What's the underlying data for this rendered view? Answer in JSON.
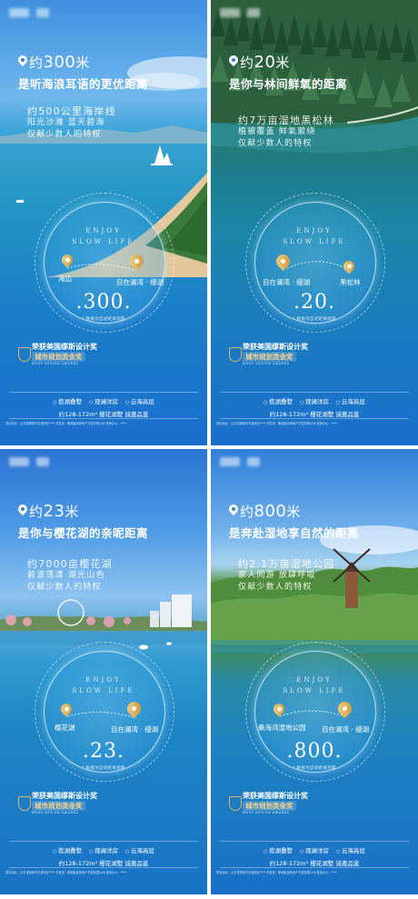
{
  "posters": [
    {
      "heading_prefix": "约",
      "heading_number": "300",
      "heading_unit": "米",
      "subtitle": "是听海浪耳语的更优距离",
      "body_line1": "约500公里海岸线",
      "body_line2": "阳光沙滩 蓝天碧海",
      "body_line3": "仅献少数人的特权",
      "enjoy_line1": "ENJOY",
      "enjoy_line2": "SLOW LIFE",
      "location_left": "海边",
      "location_right": "自在澜湾 · 缦湖",
      "big_number": ".300.",
      "note": "* 数据为自述距离测量",
      "award_line1": "荣获美国缪斯设计奖",
      "award_line2": "城市规划类金奖",
      "award_line3": "MUSE DESIGN AWARDS",
      "tags": [
        "揽湖叠墅",
        "观澜洋房",
        "云海高层"
      ],
      "spec": "约128-172m² 樱花湖墅  诚邀品鉴",
      "fine_print": "项目地址：山东省聊城市东昌府区****  开发商：聊城聚源房地产开发有限公司  营销中心：****"
    },
    {
      "heading_prefix": "约",
      "heading_number": "20",
      "heading_unit": "米",
      "subtitle": "是你与林间鲜氧的距离",
      "body_line1": "约7万亩湿地黑松林",
      "body_line2": "植被覆盖 鲜氧萦绕",
      "body_line3": "仅献少数人的特权",
      "enjoy_line1": "ENJOY",
      "enjoy_line2": "SLOW LIFE",
      "location_left": "自在澜湾 · 缦湖",
      "location_right": "黑松林",
      "big_number": ".20.",
      "note": "* 数据为自述距离测量",
      "award_line1": "荣获美国缪斯设计奖",
      "award_line2": "城市规划类金奖",
      "award_line3": "MUSE DESIGN AWARDS",
      "tags": [
        "揽湖叠墅",
        "观澜洋房",
        "云海高层"
      ],
      "spec": "约128-172m² 樱花湖墅  诚邀品鉴",
      "fine_print": "项目地址：山东省聊城市东昌府区****  开发商：聊城聚源房地产开发有限公司  营销中心：****"
    },
    {
      "heading_prefix": "约",
      "heading_number": "23",
      "heading_unit": "米",
      "subtitle": "是你与樱花湖的亲昵距离",
      "body_line1": "约7000亩樱花湖",
      "body_line2": "碧波荡漾 湖光山色",
      "body_line3": "仅献少数人的特权",
      "enjoy_line1": "ENJOY",
      "enjoy_line2": "SLOW LIFE",
      "location_left": "樱花湖",
      "location_right": "自在澜湾 · 缦湖",
      "big_number": ".23.",
      "note": "* 数据为自述距离测量",
      "award_line1": "荣获美国缪斯设计奖",
      "award_line2": "城市规划类金奖",
      "award_line3": "MUSE DESIGN AWARDS",
      "tags": [
        "揽湖叠墅",
        "观澜洋房",
        "云海高层"
      ],
      "spec": "约128-172m² 樱花湖墅  诚邀品鉴",
      "fine_print": "项目地址：山东省聊城市东昌府区****  开发商：聊城聚源房地产开发有限公司  营销中心：****"
    },
    {
      "heading_prefix": "约",
      "heading_number": "800",
      "heading_unit": "米",
      "subtitle": "是奔赴湿地享自然的距离",
      "body_line1": "约2.1万亩湿地公园",
      "body_line2": "家人同游 放肆呼吸",
      "body_line3": "仅献少数人的特权",
      "enjoy_line1": "ENJOY",
      "enjoy_line2": "SLOW LIFE",
      "location_left": "桑海湾湿地公园",
      "location_right": "自在澜湾 · 缦湖",
      "big_number": ".800.",
      "note": "* 数据为自述距离测量",
      "award_line1": "荣获美国缪斯设计奖",
      "award_line2": "城市规划类金奖",
      "award_line3": "MUSE DESIGN AWARDS",
      "tags": [
        "揽湖叠墅",
        "观澜洋房",
        "云海高层"
      ],
      "spec": "约128-172m² 樱花湖墅  诚邀品鉴",
      "fine_print": "项目地址：山东省聊城市东昌府区****  开发商：聊城聚源房地产开发有限公司  营销中心：****"
    }
  ],
  "colors": {
    "gold": "#d9b46a",
    "award_text": "#f3d28f"
  }
}
